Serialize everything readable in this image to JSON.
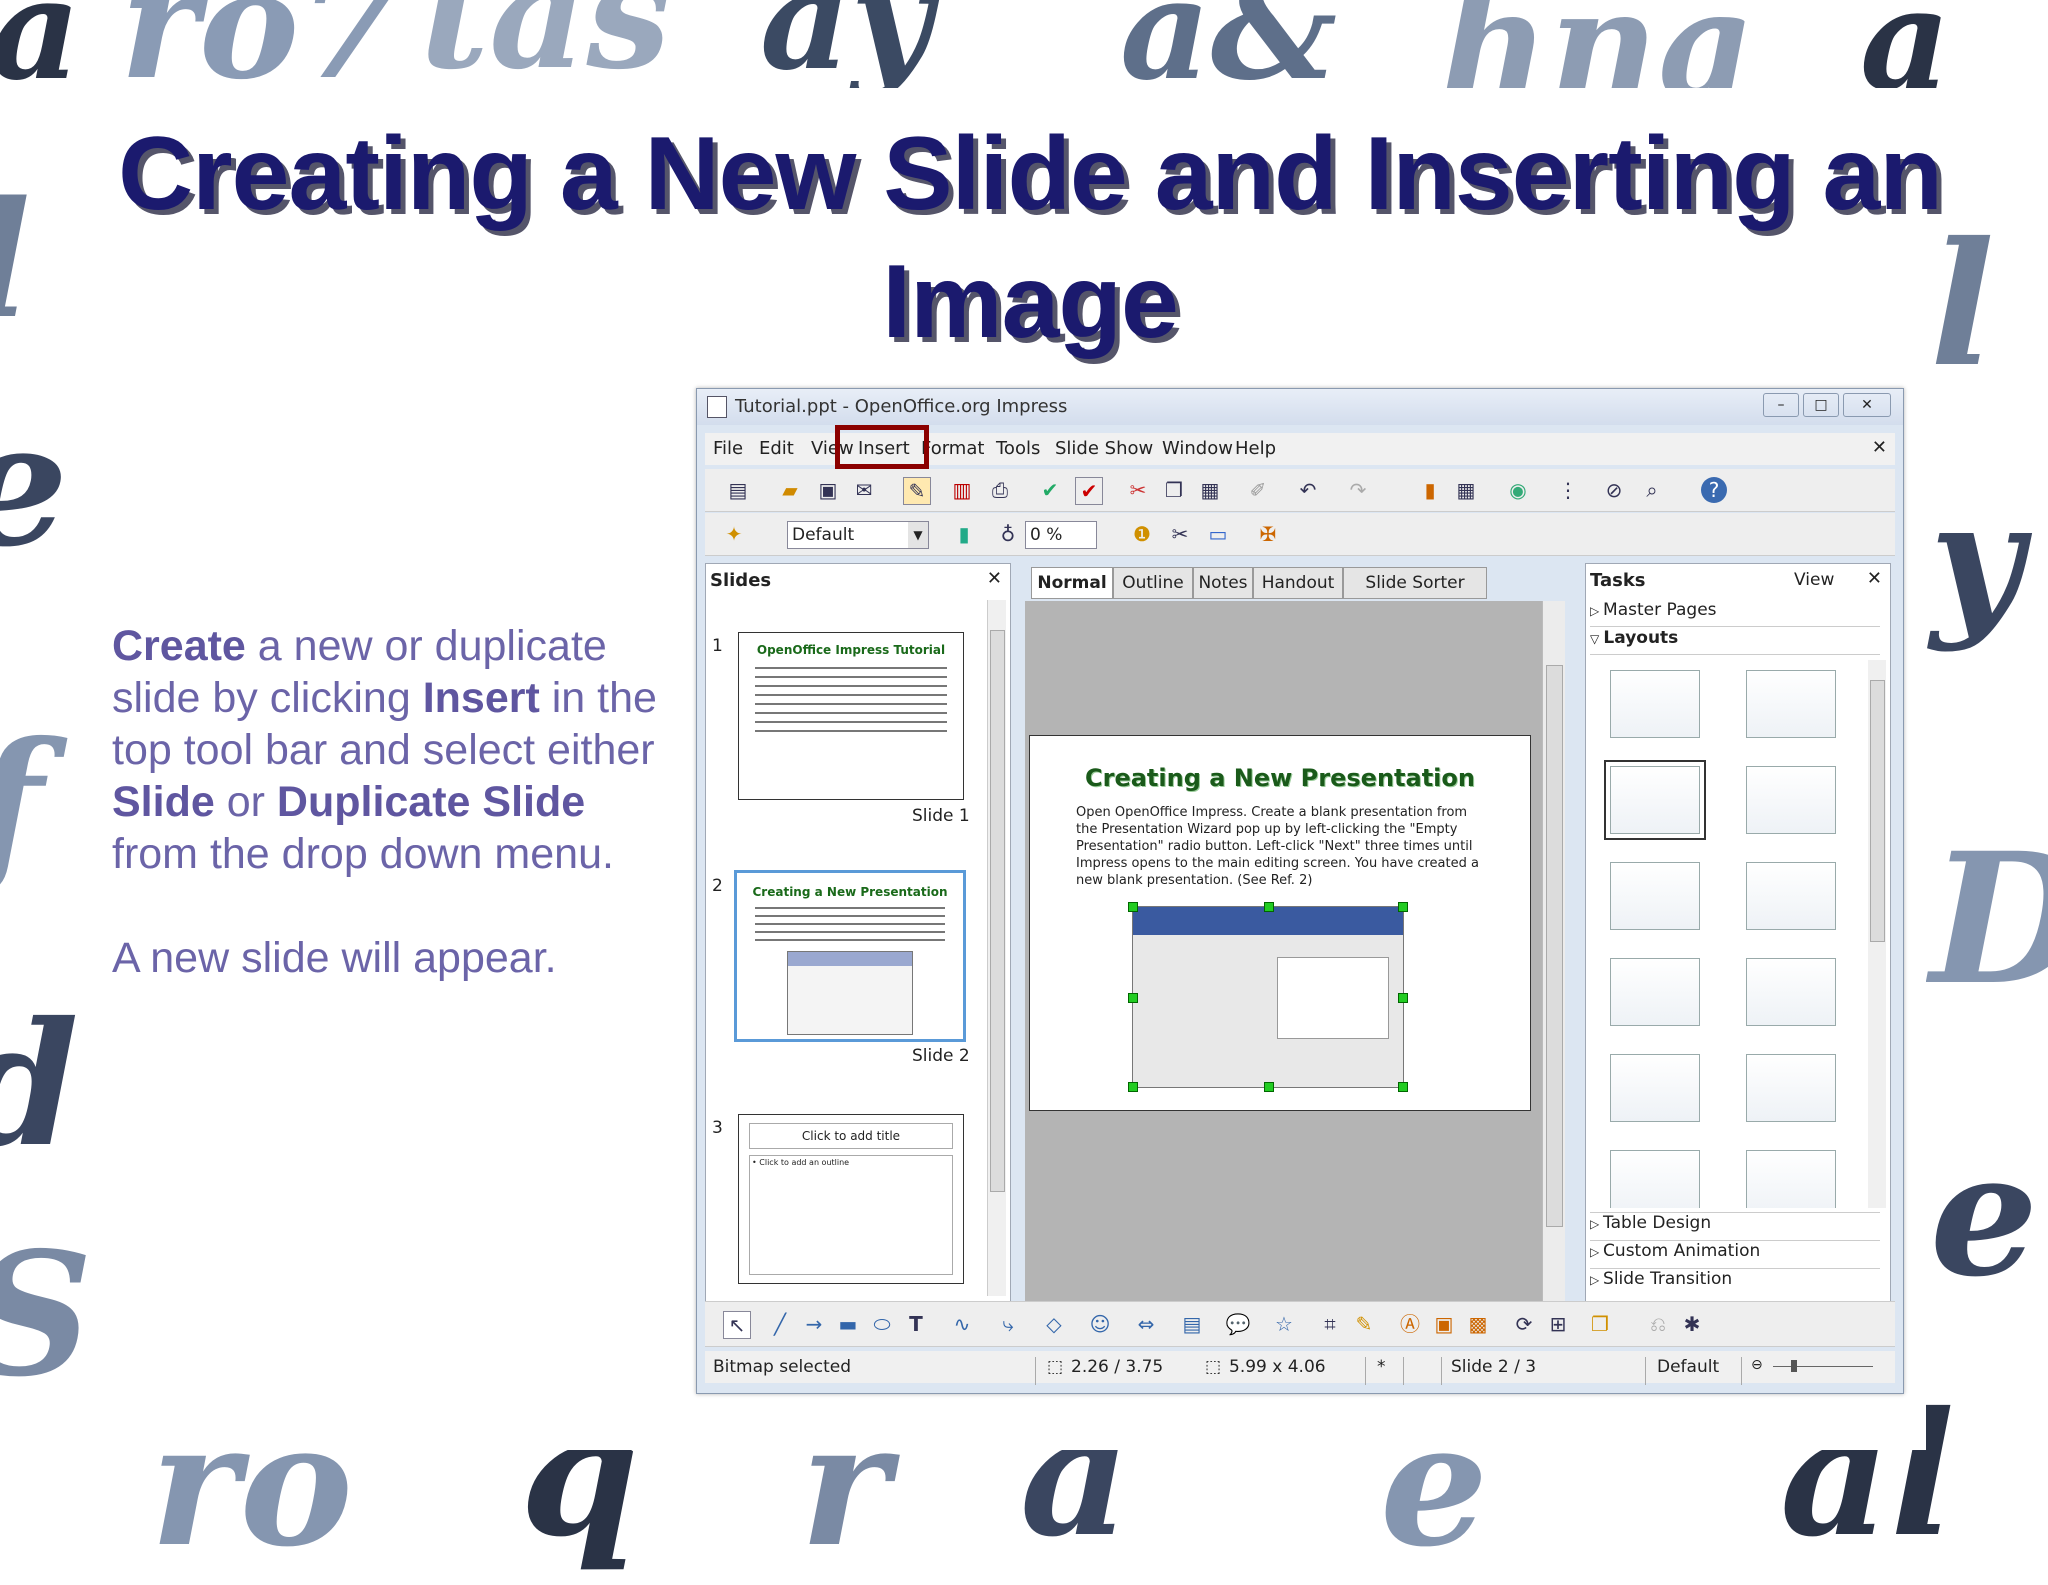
{
  "slide": {
    "title": "Creating a New Slide and Inserting an Image",
    "body": {
      "p1_w1": "Create",
      "p1_t1": " a new or duplicate slide by clicking ",
      "p1_w2": "Insert",
      "p1_t2": " in the top tool bar and select either ",
      "p1_w3": "Slide",
      "p1_t3": " or ",
      "p1_w4": "Duplicate Slide",
      "p1_t4": " from the drop down menu.",
      "p2": "A new slide will appear."
    },
    "colors": {
      "title": "#1b1a6e",
      "body": "#6b64a8",
      "highlight_box": "#8b0000"
    }
  },
  "window": {
    "title": "Tutorial.ppt - OpenOffice.org Impress",
    "menu": [
      "File",
      "Edit",
      "View",
      "Insert",
      "Format",
      "Tools",
      "Slide Show",
      "Window",
      "Help"
    ],
    "highlighted_menu": "Insert",
    "style_box": "Default",
    "transparency_box": "0 %",
    "slides_pane": {
      "title": "Slides",
      "items": [
        {
          "num": "1",
          "label": "Slide 1",
          "thumb_title": "OpenOffice Impress Tutorial"
        },
        {
          "num": "2",
          "label": "Slide 2",
          "thumb_title": "Creating a New Presentation"
        },
        {
          "num": "3",
          "label": "",
          "thumb_title": "Click to add title",
          "thumb_body": "• Click to add an outline"
        }
      ]
    },
    "view_tabs": [
      "Normal",
      "Outline",
      "Notes",
      "Handout",
      "Slide Sorter"
    ],
    "active_tab": "Normal",
    "edit_slide": {
      "title": "Creating a New Presentation",
      "text": "Open OpenOffice Impress. Create a blank presentation from the Presentation Wizard pop up by left-clicking the \"Empty Presentation\" radio button. Left-click \"Next\" three times until Impress opens to the main editing screen. You have created a new blank presentation. (See Ref. 2)"
    },
    "tasks_pane": {
      "title": "Tasks",
      "view_label": "View",
      "sections": [
        "Master Pages",
        "Layouts"
      ],
      "bottom_sections": [
        "Table Design",
        "Custom Animation",
        "Slide Transition"
      ]
    },
    "status": {
      "message": "Bitmap selected",
      "position": "2.26 / 3.75",
      "size": "5.99 x 4.06",
      "modified": "*",
      "slide": "Slide 2 / 3",
      "layout": "Default"
    }
  }
}
